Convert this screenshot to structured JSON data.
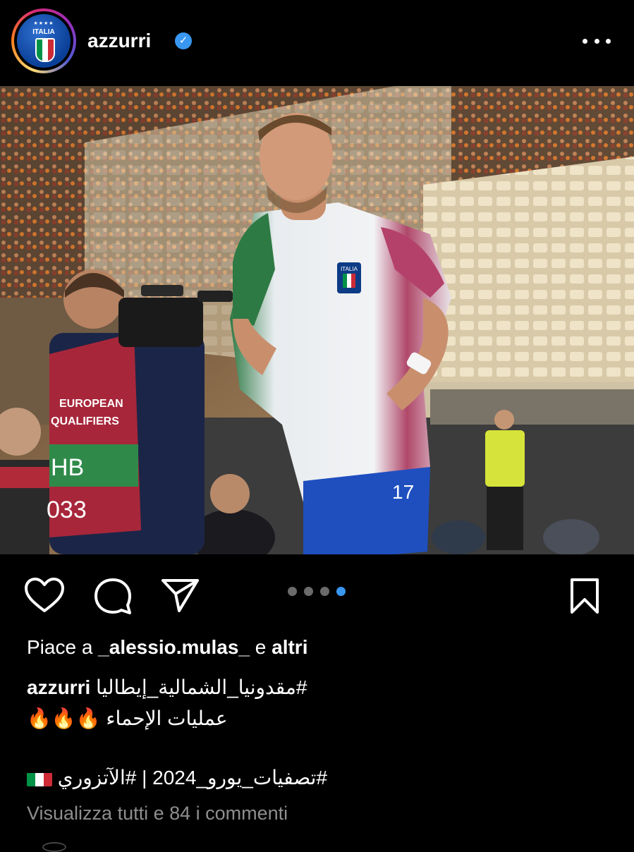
{
  "header": {
    "username": "azzurri",
    "verified": true,
    "avatar": {
      "word": "ITALIA",
      "stars": "★★★★",
      "flag_colors": [
        "#009246",
        "#ffffff",
        "#ce2b37"
      ]
    },
    "more_icon": "more-horizontal-icon"
  },
  "photo": {
    "description_icon": "photo",
    "vest_text_top": "EUROPEAN",
    "vest_text_bottom": "QUALIFIERS",
    "vest_label": "HB",
    "vest_number": "033",
    "shirt_number": "17",
    "shirt_crest": "ITALIA"
  },
  "actions": {
    "like_icon": "heart-icon",
    "comment_icon": "comment-icon",
    "share_icon": "send-icon",
    "save_icon": "bookmark-icon",
    "carousel": {
      "count": 4,
      "active_index": 3
    }
  },
  "likes": {
    "prefix": "Piace a ",
    "user": "_alessio.mulas_",
    "middle": " e ",
    "others": "altri"
  },
  "caption": {
    "user": "azzurri",
    "line1": "#مقدونيا_الشمالية_إيطاليا",
    "line2": "عمليات الإحماء 🔥🔥🔥",
    "line3": "#تصفيات_يورو_2024 | #الآتزوري"
  },
  "comments": {
    "label": "Visualizza tutti e 84 i commenti"
  },
  "colors": {
    "background": "#000000",
    "accent": "#3897f0",
    "muted": "#8e8e8e"
  }
}
